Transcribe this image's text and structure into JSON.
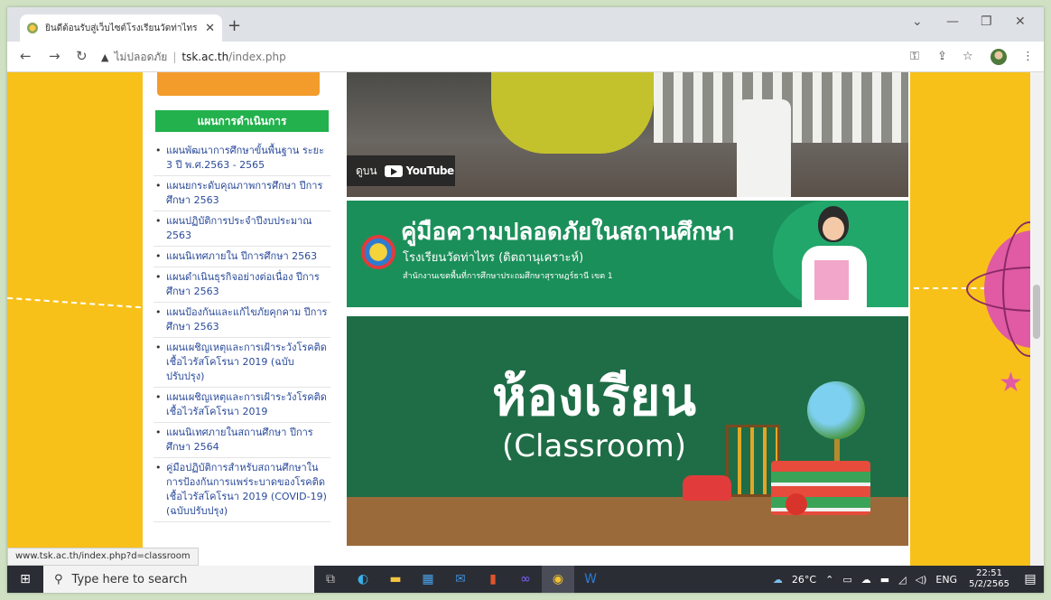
{
  "browser": {
    "tab_title": "ยินดีต้อนรับสู่เว็บไซต์โรงเรียนวัดท่าไทร",
    "tab_close": "✕",
    "new_tab": "+",
    "minimize": "—",
    "maximize": "❐",
    "close": "✕",
    "chevron": "⌄",
    "back": "←",
    "forward": "→",
    "reload": "↻",
    "security_label": "ไม่ปลอดภัย",
    "url_host": "tsk.ac.th",
    "url_path": "/index.php",
    "key_icon": "⚿",
    "share_icon": "⇪",
    "star_icon": "☆",
    "menu_icon": "⋮"
  },
  "sidebar": {
    "heading": "แผนการดำเนินการ",
    "items": [
      "แผนพัฒนาการศึกษาขั้นพื้นฐาน ระยะ 3 ปี พ.ศ.2563 - 2565",
      "แผนยกระดับคุณภาพการศึกษา ปีการศึกษา 2563",
      "แผนปฏิบัติการประจำปีงบประมาณ 2563",
      "แผนนิเทศภายใน ปีการศึกษา 2563",
      "แผนดำเนินธุรกิจอย่างต่อเนื่อง ปีการศึกษา 2563",
      "แผนป้องกันและแก้ไขภัยคุกคาม ปีการศึกษา 2563",
      "แผนเผชิญเหตุและการเฝ้าระวังโรคติดเชื้อไวรัสโคโรนา 2019 (ฉบับปรับปรุง)",
      "แผนเผชิญเหตุและการเฝ้าระวังโรคติดเชื้อไวรัสโคโรนา 2019",
      "แผนนิเทศภายในสถานศึกษา ปีการศึกษา 2564",
      "คู่มือปฏิบัติการสำหรับสถานศึกษาในการป้องกันการแพร่ระบาดของโรคติดเชื้อไวรัสโคโรนา 2019 (COVID-19)(ฉบับปรับปรุง)"
    ]
  },
  "video": {
    "watch_on": "ดูบน",
    "youtube": "YouTube"
  },
  "safety_banner": {
    "title": "คู่มือความปลอดภัยในสถานศึกษา",
    "school": "โรงเรียนวัดท่าไทร (ดิตถานุเคราะห์)",
    "office": "สำนักงานเขตพื้นที่การศึกษาประถมศึกษาสุราษฎร์ธานี เขต 1"
  },
  "classroom_banner": {
    "title": "ห้องเรียน",
    "subtitle": "(Classroom)"
  },
  "status_url": "www.tsk.ac.th/index.php?d=classroom",
  "taskbar": {
    "search_placeholder": "Type here to search",
    "weather": "26°C",
    "lang": "ENG",
    "time": "22:51",
    "date": "5/2/2565"
  }
}
